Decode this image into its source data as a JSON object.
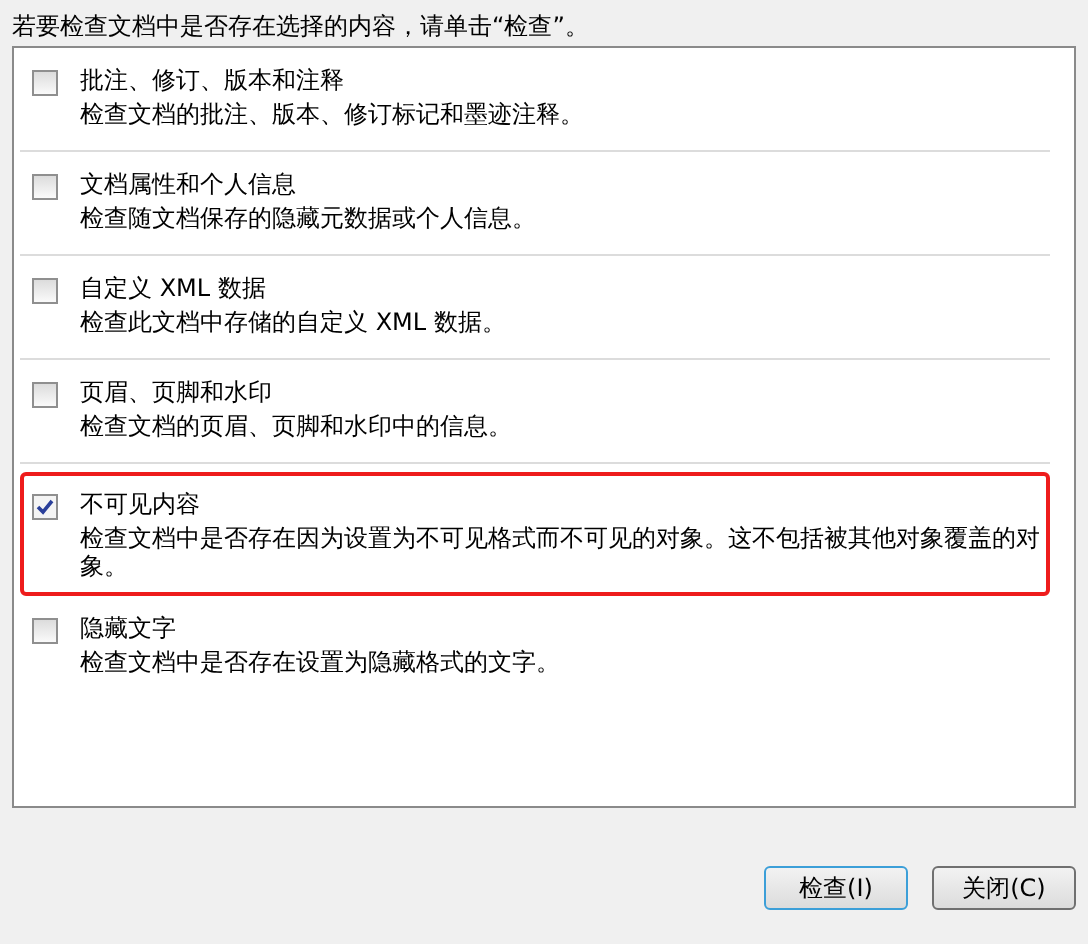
{
  "instruction": "若要检查文档中是否存在选择的内容，请单击“检查”。",
  "items": [
    {
      "title": "批注、修订、版本和注释",
      "description": "检查文档的批注、版本、修订标记和墨迹注释。",
      "checked": false,
      "highlighted": false
    },
    {
      "title": "文档属性和个人信息",
      "description": "检查随文档保存的隐藏元数据或个人信息。",
      "checked": false,
      "highlighted": false
    },
    {
      "title": "自定义 XML 数据",
      "description": "检查此文档中存储的自定义 XML 数据。",
      "checked": false,
      "highlighted": false
    },
    {
      "title": "页眉、页脚和水印",
      "description": "检查文档的页眉、页脚和水印中的信息。",
      "checked": false,
      "highlighted": false
    },
    {
      "title": "不可见内容",
      "description": "检查文档中是否存在因为设置为不可见格式而不可见的对象。这不包括被其他对象覆盖的对象。",
      "checked": true,
      "highlighted": true
    },
    {
      "title": "隐藏文字",
      "description": "检查文档中是否存在设置为隐藏格式的文字。",
      "checked": false,
      "highlighted": false
    }
  ],
  "buttons": [
    {
      "label": "检查(I)",
      "default": true
    },
    {
      "label": "关闭(C)",
      "default": false
    }
  ]
}
